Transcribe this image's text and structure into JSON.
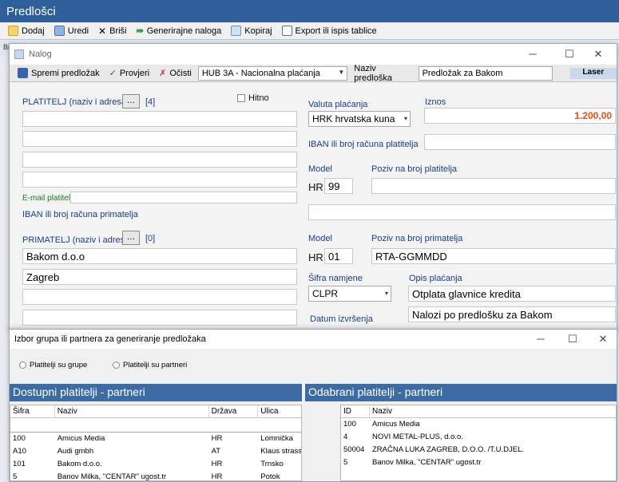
{
  "main": {
    "title": "Predlošci",
    "toolbar": [
      {
        "label": "Dodaj",
        "icon": "add-icon"
      },
      {
        "label": "Uredi",
        "icon": "edit-icon"
      },
      {
        "label": "Briši",
        "icon": "delete-icon"
      },
      {
        "label": "Generirajne naloga",
        "icon": "generate-icon"
      },
      {
        "label": "Kopiraj",
        "icon": "copy-icon"
      },
      {
        "label": "Export ili ispis tablice",
        "icon": "table-icon"
      }
    ],
    "bg_text": "Br"
  },
  "nalog": {
    "title": "Nalog",
    "toolbar": {
      "save": "Spremi predložak",
      "check": "Provjeri",
      "clear": "Očisti",
      "type_value": "HUB 3A - Nacionalna plaćanja",
      "template_name_label": "Naziv predloška",
      "template_name_value": "Predložak za Bakom",
      "laser": "Laser"
    },
    "platitelj_label": "PLATITELJ (naziv i adresa)",
    "platitelj_count": "[4]",
    "hitno": "Hitno",
    "email_label": "E-mail platitelja",
    "iban_primatelj_label": "IBAN ili broj računa primatelja",
    "primatelj_label": "PRIMATELJ (naziv i adresa)",
    "primatelj_count": "[0]",
    "primatelj_lines": [
      "Bakom d.o.o",
      "Zagreb",
      "",
      ""
    ],
    "valuta_label": "Valuta plaćanja",
    "valuta_value": "HRK hrvatska kuna",
    "iznos_label": "Iznos",
    "iznos_value": "1.200,00",
    "iban_platitelj_label": "IBAN ili broj računa platitelja",
    "model_label": "Model",
    "poziv_platitelj_label": "Poziv na broj platitelja",
    "model_platitelj_prefix": "HR",
    "model_platitelj_value": "99",
    "model2_label": "Model",
    "poziv_primatelj_label": "Poziv na broj primatelja",
    "model_primatelj_prefix": "HR",
    "model_primatelj_value": "01",
    "poziv_primatelj_value": "RTA-GGMMDD",
    "sifra_label": "Šifra namjene",
    "sifra_value": "CLPR",
    "opis_label": "Opis plaćanja",
    "opis_value": "Otplata glavnice kredita",
    "opis2_value": "Nalozi po predlošku za Bakom",
    "datum_label": "Datum izvršenja"
  },
  "izbor": {
    "title": "Izbor grupa ili partnera za generiranje predložaka",
    "radio_groups": "Platitelji su grupe",
    "radio_partners": "Platitelji su partneri",
    "left_head": "Dostupni platitelji - partneri",
    "right_head": "Odabrani platitelji - partneri",
    "left_columns": [
      "Šifra",
      "Naziv",
      "Država",
      "Ulica"
    ],
    "left_rows": [
      [
        "100",
        "Amicus Media",
        "HR",
        "Lomnička"
      ],
      [
        "A10",
        "Audi gmbh",
        "AT",
        "Klaus strasse"
      ],
      [
        "101",
        "Bakom d.o.o.",
        "HR",
        "Trnsko"
      ],
      [
        "5",
        "Banov Milka, \"CENTAR\" ugost.tr",
        "HR",
        "Potok"
      ]
    ],
    "right_columns": [
      "ID",
      "Naziv"
    ],
    "right_rows": [
      [
        "100",
        "Amicus Media"
      ],
      [
        "4",
        "NOVI METAL-PLUS, d.o.o."
      ],
      [
        "50004",
        "ZRAČNA LUKA ZAGREB, D.O.O. /T.U.DJEL."
      ],
      [
        "5",
        "Banov Milka, \"CENTAR\" ugost.tr"
      ]
    ]
  },
  "colors": {
    "title_bar": "#2f5f9a",
    "panel_head": "#3d6ba5",
    "amount": "#e0501a"
  }
}
